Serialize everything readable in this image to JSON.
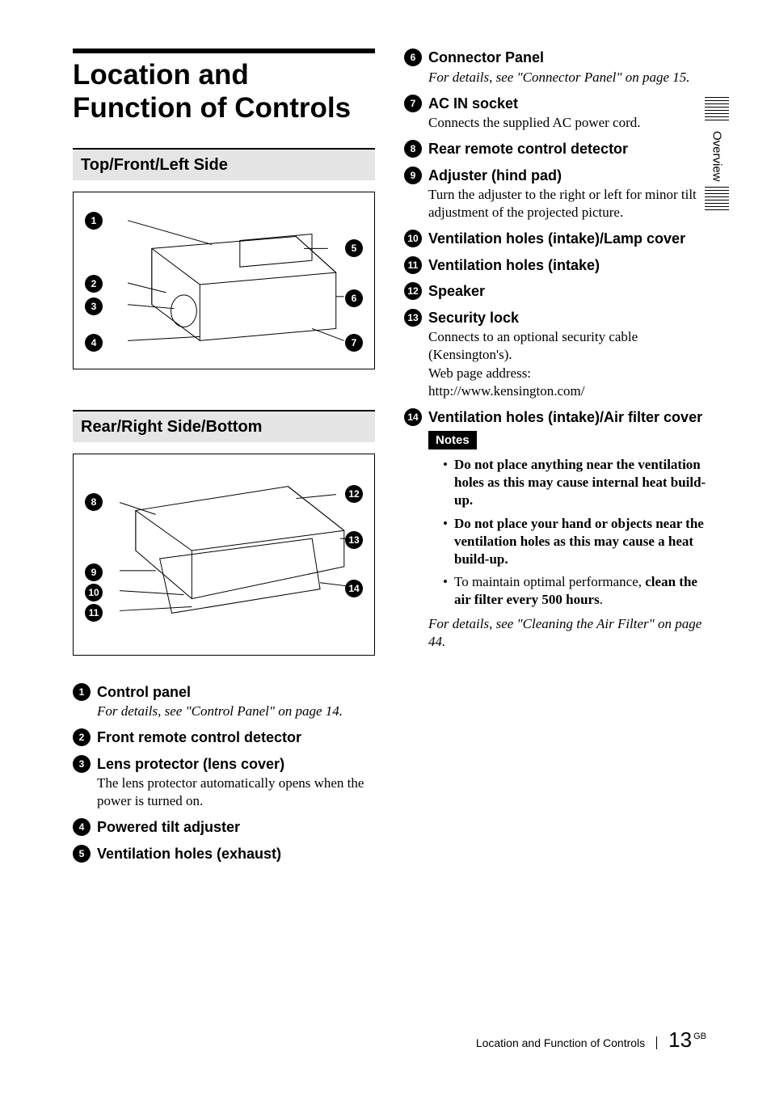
{
  "doc": {
    "title": "Location and Function of Controls",
    "side_tab": "Overview",
    "footer_title": "Location and Function of Controls",
    "page_number": "13",
    "locale_badge": "GB"
  },
  "sections": {
    "top_front_left": "Top/Front/Left Side",
    "rear_right_bottom": "Rear/Right Side/Bottom"
  },
  "notes_label": "Notes",
  "items": [
    {
      "n": "1",
      "title": "Control panel",
      "desc_italic": "For details, see \"Control Panel\" on page 14."
    },
    {
      "n": "2",
      "title": "Front remote control detector"
    },
    {
      "n": "3",
      "title": "Lens protector (lens cover)",
      "desc": "The lens protector automatically opens when the power is turned on."
    },
    {
      "n": "4",
      "title": "Powered tilt adjuster"
    },
    {
      "n": "5",
      "title": "Ventilation holes (exhaust)"
    },
    {
      "n": "6",
      "title": "Connector Panel",
      "desc_italic": "For details, see \"Connector Panel\" on page 15."
    },
    {
      "n": "7",
      "title": "AC IN socket",
      "desc": "Connects the supplied AC power cord."
    },
    {
      "n": "8",
      "title": "Rear remote control detector"
    },
    {
      "n": "9",
      "title": "Adjuster (hind pad)",
      "desc": "Turn the adjuster to the right or left for minor tilt adjustment of the projected picture."
    },
    {
      "n": "10",
      "title": "Ventilation holes (intake)/Lamp cover"
    },
    {
      "n": "11",
      "title": "Ventilation holes (intake)"
    },
    {
      "n": "12",
      "title": "Speaker"
    },
    {
      "n": "13",
      "title": "Security lock",
      "desc": "Connects to an optional security cable (Kensington's).\nWeb page address:\nhttp://www.kensington.com/"
    },
    {
      "n": "14",
      "title": "Ventilation holes (intake)/Air filter cover"
    }
  ],
  "notes": {
    "bullets": [
      {
        "bold": "Do not place anything near the ventilation holes as this may cause internal heat build-up."
      },
      {
        "bold": "Do not place your hand or objects near the ventilation holes as this may cause a heat build-up."
      },
      {
        "plain": "To maintain optimal performance, ",
        "bold": "clean the air filter every 500 hours",
        "tail": "."
      }
    ],
    "footer": "For details, see \"Cleaning the Air Filter\" on page 44."
  },
  "callouts_fig1": [
    "1",
    "2",
    "3",
    "4",
    "5",
    "6",
    "7"
  ],
  "callouts_fig2": [
    "8",
    "9",
    "10",
    "11",
    "12",
    "13",
    "14"
  ]
}
